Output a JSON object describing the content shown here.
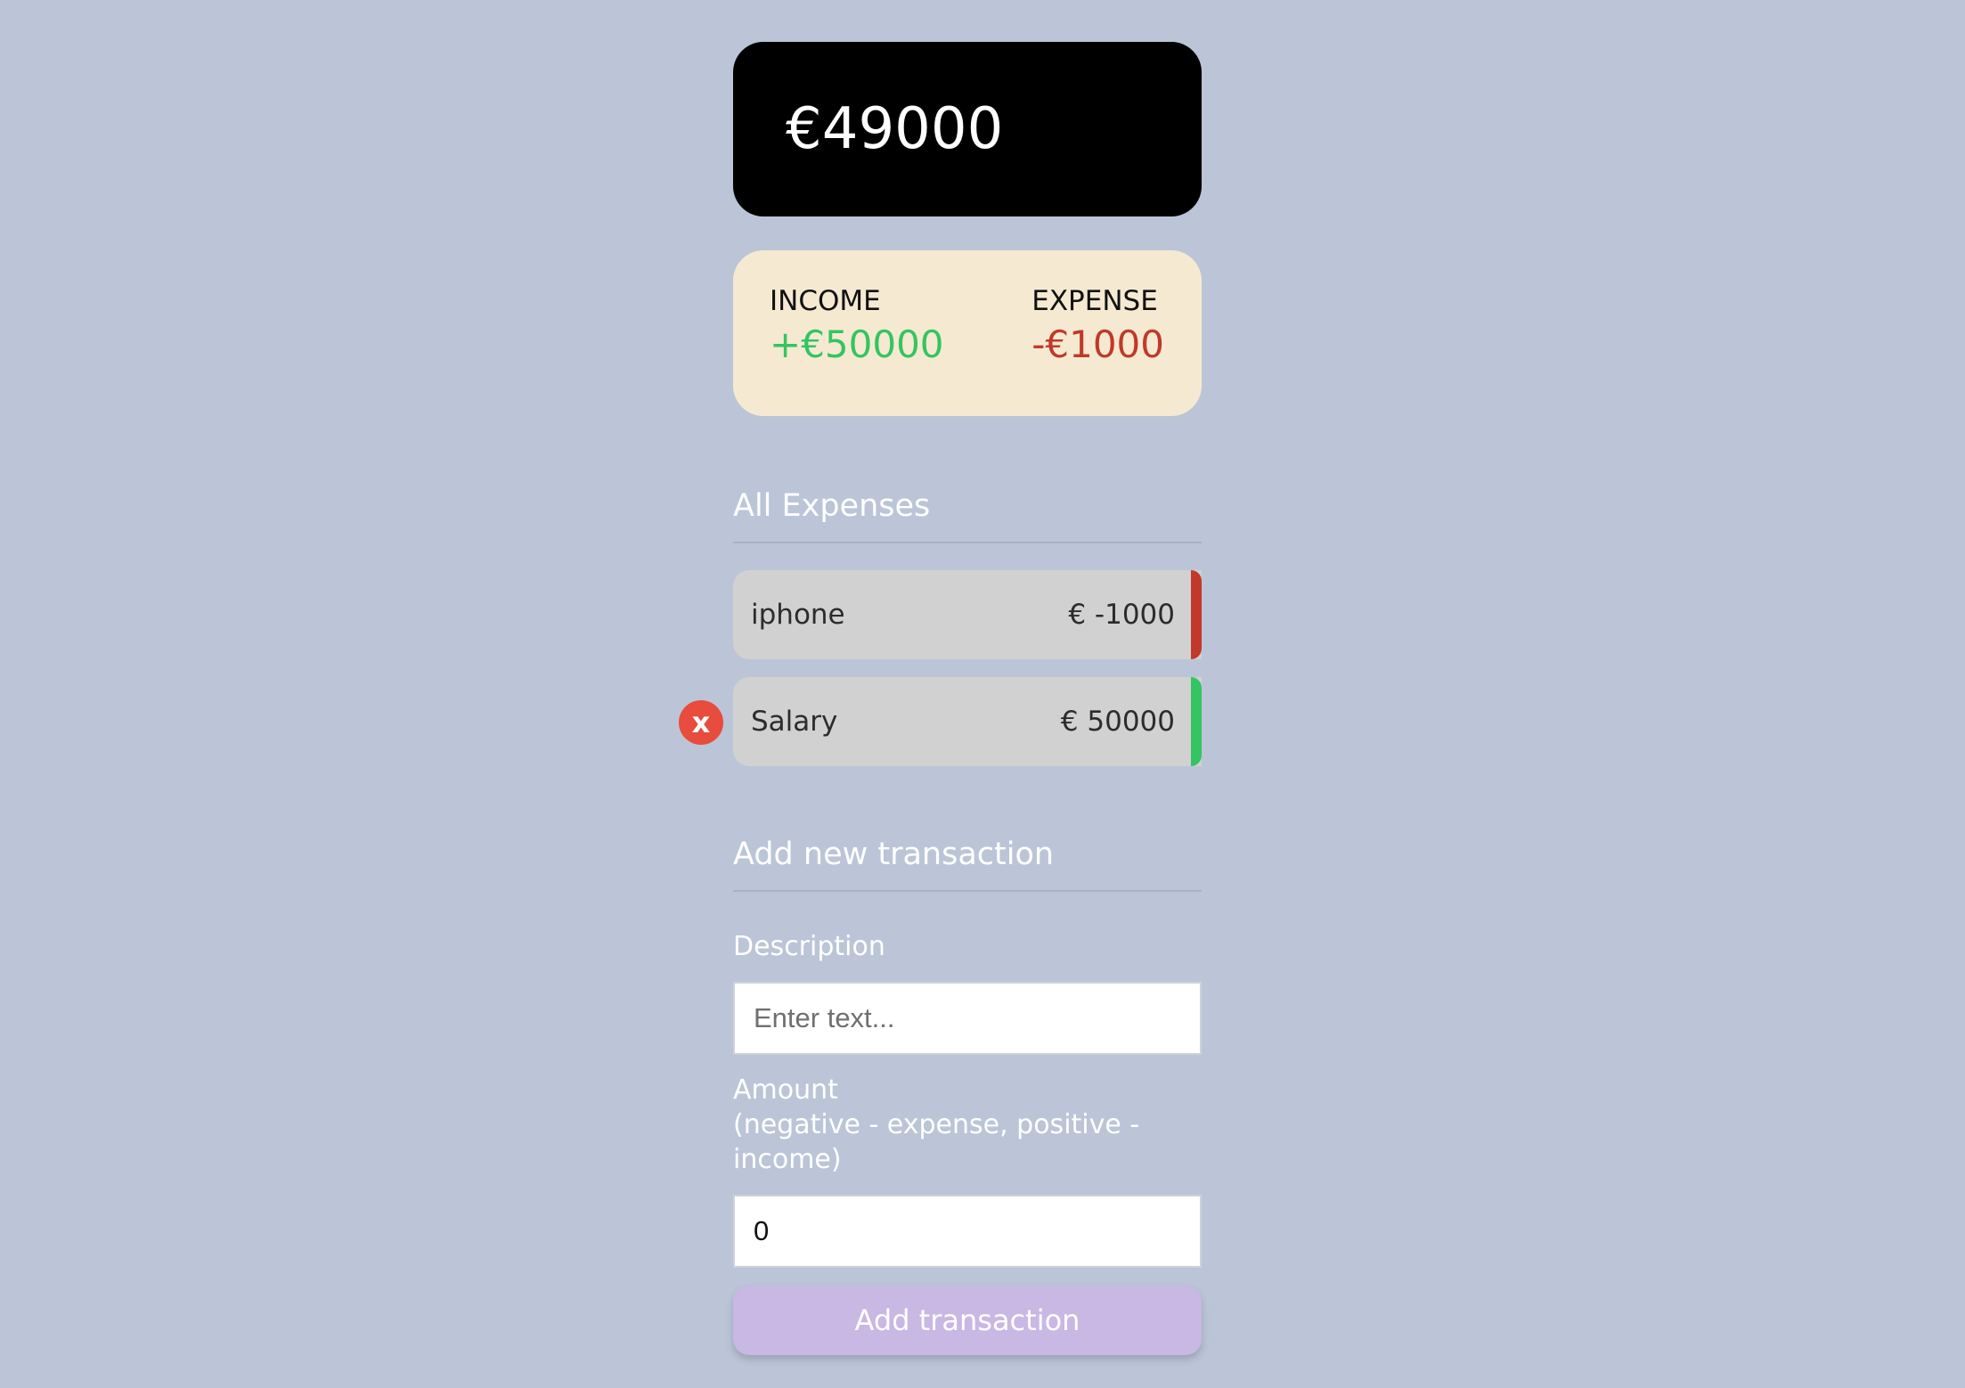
{
  "balance": "€49000",
  "summary": {
    "income_label": "INCOME",
    "income_value": "+€50000",
    "expense_label": "EXPENSE",
    "expense_value": "-€1000"
  },
  "history": {
    "title": "All Expenses",
    "transactions": [
      {
        "description": "iphone",
        "amount": "€ -1000",
        "type": "expense"
      },
      {
        "description": "Salary",
        "amount": "€ 50000",
        "type": "income"
      }
    ],
    "delete_label": "x"
  },
  "add_form": {
    "title": "Add new transaction",
    "description_label": "Description",
    "description_placeholder": "Enter text...",
    "amount_label": "Amount",
    "amount_hint": "(negative - expense, positive - income)",
    "amount_value": "0",
    "submit_label": "Add transaction"
  },
  "colors": {
    "background": "#bbc5d7",
    "balance_card": "#000000",
    "summary_card": "#f5ead1",
    "income": "#34c462",
    "expense": "#c0392b",
    "delete": "#e74c3c",
    "button": "#c8b8e3"
  },
  "icons": {
    "delete": "close-icon"
  }
}
